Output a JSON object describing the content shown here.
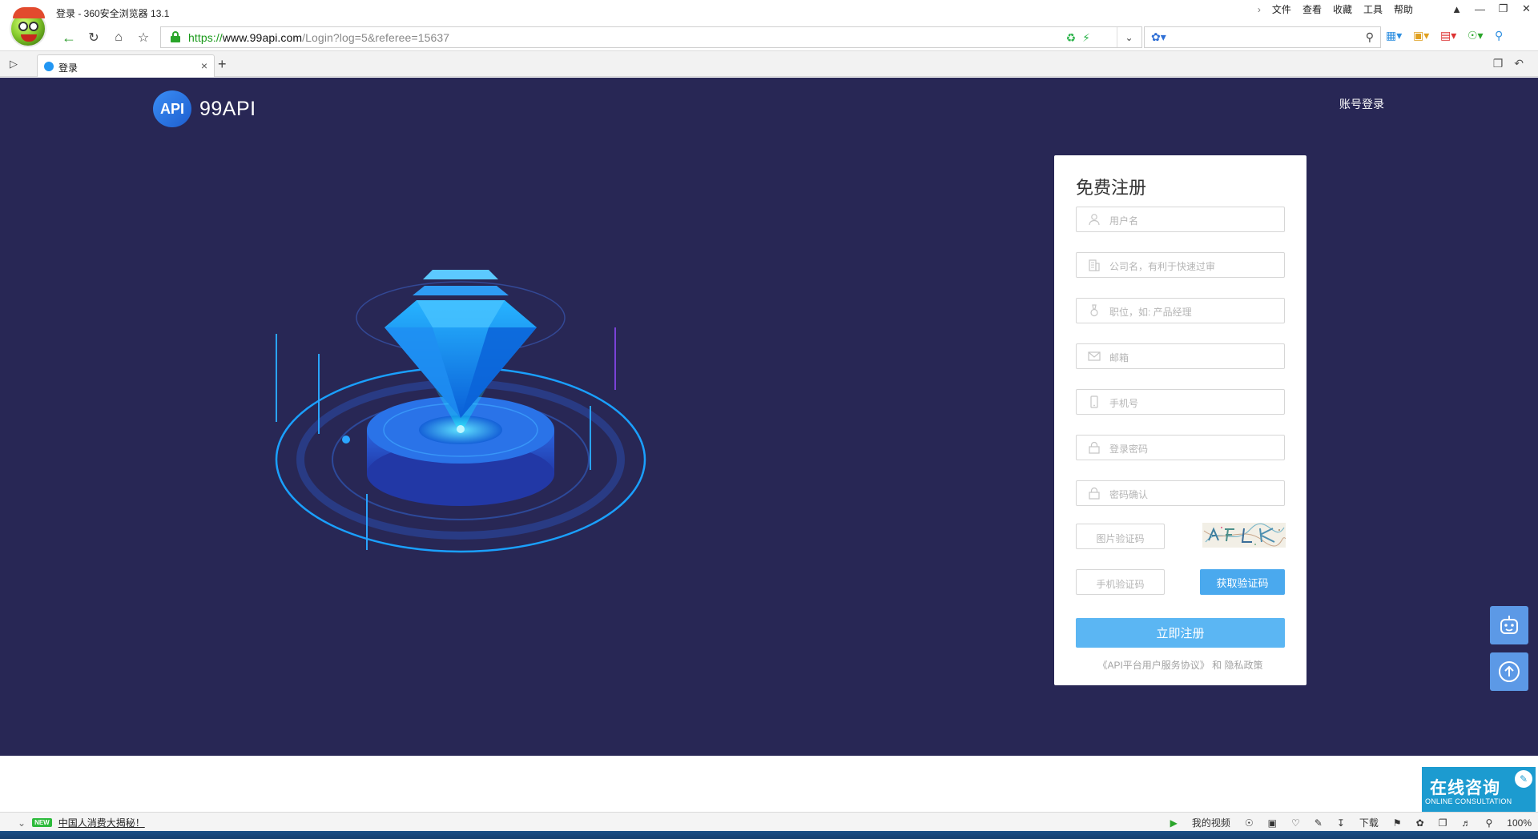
{
  "browser": {
    "window_title": "登录 - 360安全浏览器 13.1",
    "menu": [
      "文件",
      "查看",
      "收藏",
      "工具",
      "帮助"
    ],
    "url": {
      "protocol": "https://",
      "host": "www.99api.com",
      "path": "/Login?log=5&referee=15637"
    },
    "tab_title": "登录",
    "status_news": "中国人消费大揭秘！",
    "status_new_badge": "NEW",
    "status_items": {
      "video": "我的视频",
      "download": "下载",
      "zoom": "100%"
    }
  },
  "page": {
    "logo_badge": "API",
    "logo_text": "99API",
    "account_login": "账号登录",
    "form": {
      "title": "免费注册",
      "fields": [
        {
          "placeholder": "用户名",
          "icon": "user-icon"
        },
        {
          "placeholder": "公司名，有利于快速过审",
          "icon": "building-icon"
        },
        {
          "placeholder": "职位，如: 产品经理",
          "icon": "badge-icon"
        },
        {
          "placeholder": "邮箱",
          "icon": "mail-icon"
        },
        {
          "placeholder": "手机号",
          "icon": "phone-icon"
        },
        {
          "placeholder": "登录密码",
          "icon": "lock-icon"
        },
        {
          "placeholder": "密码确认",
          "icon": "lock-icon"
        }
      ],
      "image_code_placeholder": "图片验证码",
      "sms_code_placeholder": "手机验证码",
      "get_code_button": "获取验证码",
      "submit_button": "立即注册",
      "agreement_link": "《API平台用户服务协议》",
      "agreement_and": "和",
      "privacy_link": "隐私政策"
    },
    "consult": {
      "title": "在线咨询",
      "subtitle": "ONLINE CONSULTATION"
    },
    "colors": {
      "background": "#282755",
      "accent": "#4aa9ee",
      "submit": "#5bb6f3"
    }
  }
}
